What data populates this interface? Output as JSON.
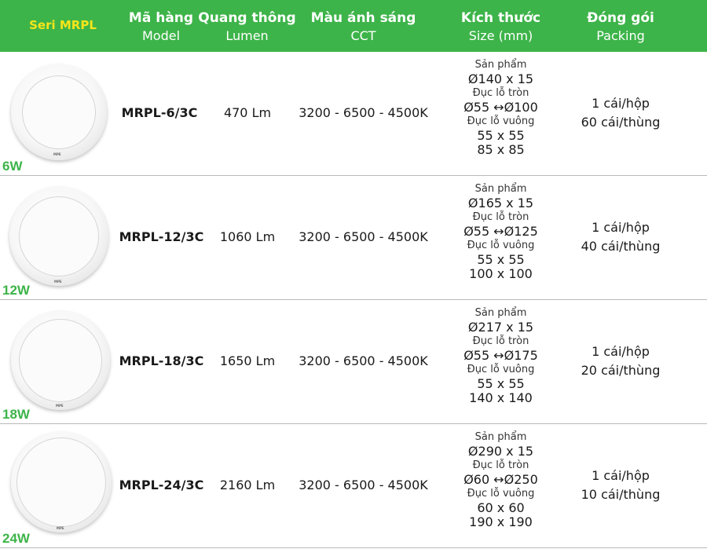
{
  "header": {
    "series": "Seri MRPL",
    "model_vn": "Mã hàng",
    "model_en": "Model",
    "lumen_vn": "Quang thông",
    "lumen_en": "Lumen",
    "cct_vn": "Màu ánh sáng",
    "cct_en": "CCT",
    "size_vn": "Kích thước",
    "size_en": "Size (mm)",
    "pack_vn": "Đóng gói",
    "pack_en": "Packing"
  },
  "colors": {
    "header_bg": "#3db449",
    "series_text": "#f6e51a",
    "watt_text": "#3db449"
  },
  "rows": [
    {
      "watt": "6W",
      "model": "MRPL-6/3C",
      "lumen": "470 Lm",
      "cct": "3200 - 6500 - 4500K",
      "size": {
        "product_label": "Sản phẩm",
        "product": "Ø140 x 15",
        "round_label": "Đục lỗ tròn",
        "round": "Ø55 ↔Ø100",
        "square_label": "Đục lỗ vuông",
        "square1": "55 x 55",
        "square2": "85 x 85"
      },
      "pack1": "1 cái/hộp",
      "pack2": "60 cái/thùng",
      "logo": "MPE"
    },
    {
      "watt": "12W",
      "model": "MRPL-12/3C",
      "lumen": "1060 Lm",
      "cct": "3200 - 6500 - 4500K",
      "size": {
        "product_label": "Sản phẩm",
        "product": "Ø165 x 15",
        "round_label": "Đục lỗ tròn",
        "round": "Ø55 ↔Ø125",
        "square_label": "Đục lỗ vuông",
        "square1": "55 x 55",
        "square2": "100 x 100"
      },
      "pack1": "1 cái/hộp",
      "pack2": "40 cái/thùng",
      "logo": "MPE"
    },
    {
      "watt": "18W",
      "model": "MRPL-18/3C",
      "lumen": "1650 Lm",
      "cct": "3200 - 6500 - 4500K",
      "size": {
        "product_label": "Sản phẩm",
        "product": "Ø217 x 15",
        "round_label": "Đục lỗ tròn",
        "round": "Ø55 ↔Ø175",
        "square_label": "Đục lỗ vuông",
        "square1": "55 x 55",
        "square2": "140 x 140"
      },
      "pack1": "1 cái/hộp",
      "pack2": "20 cái/thùng",
      "logo": "MPE"
    },
    {
      "watt": "24W",
      "model": "MRPL-24/3C",
      "lumen": "2160 Lm",
      "cct": "3200 - 6500 - 4500K",
      "size": {
        "product_label": "Sản phẩm",
        "product": "Ø290 x 15",
        "round_label": "Đục lỗ tròn",
        "round": "Ø60 ↔Ø250",
        "square_label": "Đục lỗ vuông",
        "square1": "60 x 60",
        "square2": "190 x 190"
      },
      "pack1": "1 cái/hộp",
      "pack2": "10 cái/thùng",
      "logo": "MPE"
    }
  ]
}
